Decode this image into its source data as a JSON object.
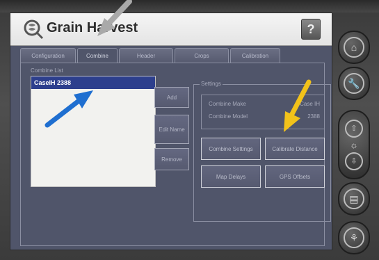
{
  "app": {
    "title": "Grain Harvest",
    "help_label": "?"
  },
  "tabs": [
    {
      "label": "Configuration",
      "active": false
    },
    {
      "label": "Combine",
      "active": true
    },
    {
      "label": "Header",
      "active": false
    },
    {
      "label": "Crops",
      "active": false
    },
    {
      "label": "Calibration",
      "active": false
    }
  ],
  "combine_list": {
    "label": "Combine List",
    "items": [
      {
        "name": "CaseIH 2388",
        "selected": true
      }
    ]
  },
  "list_buttons": {
    "add": "Add",
    "edit_name": "Edit Name",
    "remove": "Remove"
  },
  "settings": {
    "label": "Settings",
    "make_label": "Combine Make",
    "make_value": "Case IH",
    "model_label": "Combine Model",
    "model_value": "2388",
    "buttons": {
      "combine_settings": "Combine Settings",
      "calibrate_distance": "Calibrate Distance",
      "map_delays": "Map Delays",
      "gps_offsets": "GPS Offsets"
    }
  },
  "colors": {
    "screen_bg": "#50556a",
    "list_selected": "#2d3f8d",
    "annotation_gray": "#a9a9a9",
    "annotation_blue": "#1f6fd0",
    "annotation_yellow": "#f2c21a"
  },
  "hardware_buttons": [
    {
      "icon": "home-icon"
    },
    {
      "icon": "wrench-icon"
    },
    {
      "icon": "brightness-up-down-icon"
    },
    {
      "icon": "document-icon"
    },
    {
      "icon": "operator-run-icon"
    }
  ]
}
